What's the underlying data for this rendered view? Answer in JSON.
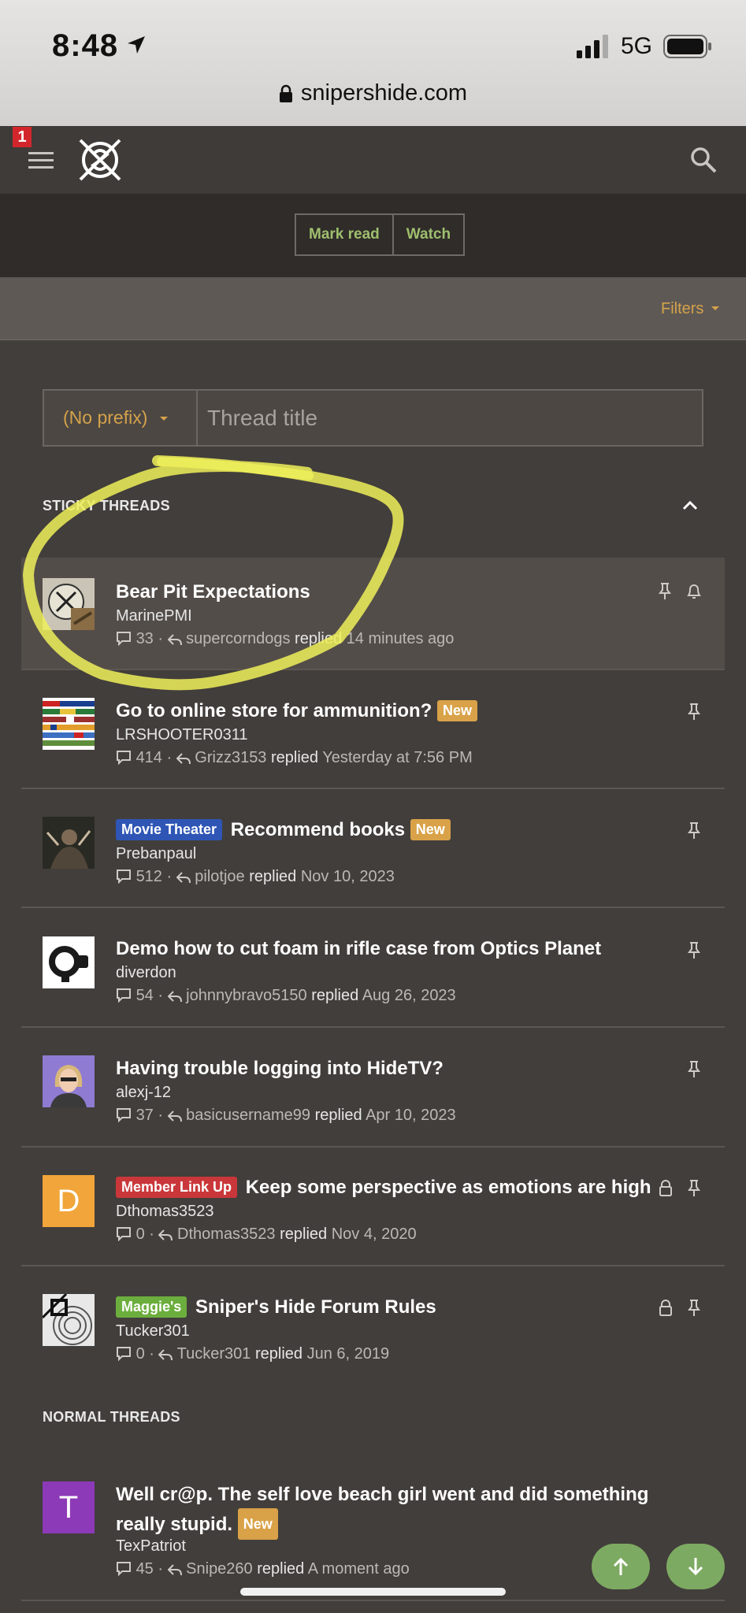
{
  "status_bar": {
    "time": "8:48",
    "network": "5G",
    "url": "snipershide.com"
  },
  "nav": {
    "notification_count": "1"
  },
  "actions": {
    "mark_read": "Mark read",
    "watch": "Watch"
  },
  "filters": {
    "label": "Filters"
  },
  "quick_thread": {
    "prefix": "(No prefix)",
    "title_placeholder": "Thread title"
  },
  "sections": {
    "sticky": "STICKY THREADS",
    "normal": "NORMAL THREADS"
  },
  "threads": [
    {
      "title": "Bear Pit Expectations",
      "author": "MarinePMI",
      "replies": "33",
      "last_user": "supercorndogs",
      "replied": "replied",
      "when": "14 minutes ago"
    },
    {
      "title": "Go to online store for ammunition?",
      "badge": "New",
      "author": "LRSHOOTER0311",
      "replies": "414",
      "last_user": "Grizz3153",
      "replied": "replied",
      "when": "Yesterday at 7:56 PM"
    },
    {
      "prefix": "Movie Theater",
      "title": "Recommend books",
      "badge": "New",
      "author": "Prebanpaul",
      "replies": "512",
      "last_user": "pilotjoe",
      "replied": "replied",
      "when": "Nov 10, 2023"
    },
    {
      "title": "Demo how to cut foam in rifle case from Optics Planet",
      "author": "diverdon",
      "replies": "54",
      "last_user": "johnnybravo5150",
      "replied": "replied",
      "when": "Aug 26, 2023"
    },
    {
      "title": "Having trouble logging into HideTV?",
      "author": "alexj-12",
      "replies": "37",
      "last_user": "basicusername99",
      "replied": "replied",
      "when": "Apr 10, 2023"
    },
    {
      "prefix": "Member Link Up",
      "title": "Keep some perspective as emotions are high",
      "author": "Dthomas3523",
      "avatar_letter": "D",
      "replies": "0",
      "last_user": "Dthomas3523",
      "replied": "replied",
      "when": "Nov 4, 2020"
    },
    {
      "prefix": "Maggie's",
      "title": "Sniper's Hide Forum Rules",
      "author": "Tucker301",
      "replies": "0",
      "last_user": "Tucker301",
      "replied": "replied",
      "when": "Jun 6, 2019"
    },
    {
      "title": "Well cr@p. The self love beach girl went and did something really stupid.",
      "badge": "New",
      "author": "TexPatriot",
      "avatar_letter": "T",
      "replies": "45",
      "last_user": "Snipe260",
      "replied": "replied",
      "when": "A moment ago"
    }
  ],
  "colors": {
    "accent_orange": "#d4a24a",
    "accent_green": "#9fbf6e",
    "label_blue": "#2f55b5",
    "label_red": "#c9373a",
    "label_green": "#6cae3d",
    "badge_new": "#d9a248",
    "annotation_yellow": "#eef05a"
  },
  "icons": [
    "location-arrow-icon",
    "signal-icon",
    "battery-icon",
    "lock-icon",
    "menu-icon",
    "logo-icon",
    "search-icon",
    "chevron-down-icon",
    "chevron-up-icon",
    "comment-icon",
    "reply-icon",
    "pin-icon",
    "bell-icon",
    "arrow-up-icon",
    "arrow-down-icon"
  ]
}
